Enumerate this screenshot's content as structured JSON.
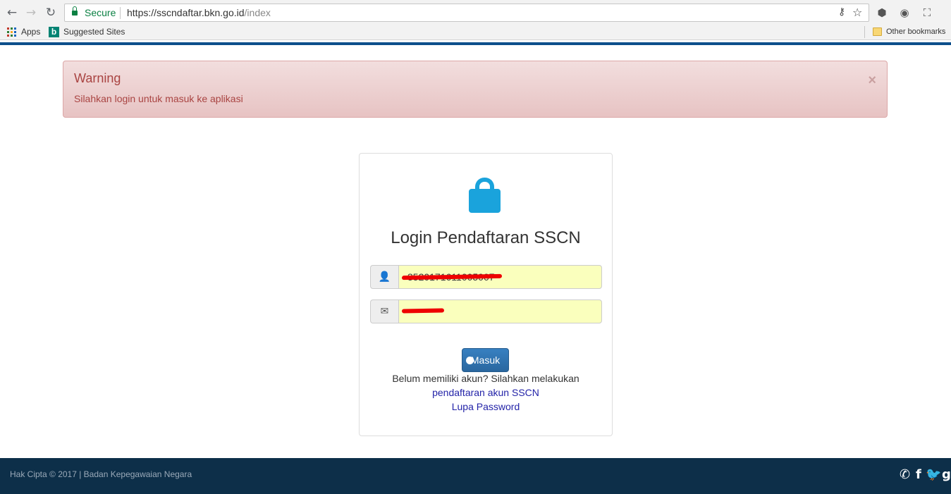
{
  "browser": {
    "security_label": "Secure",
    "url_host": "https://sscndaftar.bkn.go.id",
    "url_path": "/index",
    "bookmarks": {
      "apps": "Apps",
      "suggested": "Suggested Sites",
      "other": "Other bookmarks"
    }
  },
  "alert": {
    "title": "Warning",
    "message": "Silahkan login untuk masuk ke aplikasi",
    "close": "×"
  },
  "login": {
    "title": "Login Pendaftaran SSCN",
    "username_value": "3520171611005007",
    "password_value": "••••••",
    "submit_label": "Masuk",
    "help_text": "Belum memiliki akun? Silahkan melakukan",
    "register_link": "pendaftaran akun SSCN",
    "forgot_link": "Lupa Password"
  },
  "footer": {
    "copyright": "Hak Cipta © 2017 | Badan Kepegawaian Negara"
  },
  "colors": {
    "accent": "#1aa3dc",
    "alert_text": "#a94442",
    "footer_bg": "#0d2f49",
    "autofill": "#faffbd"
  }
}
